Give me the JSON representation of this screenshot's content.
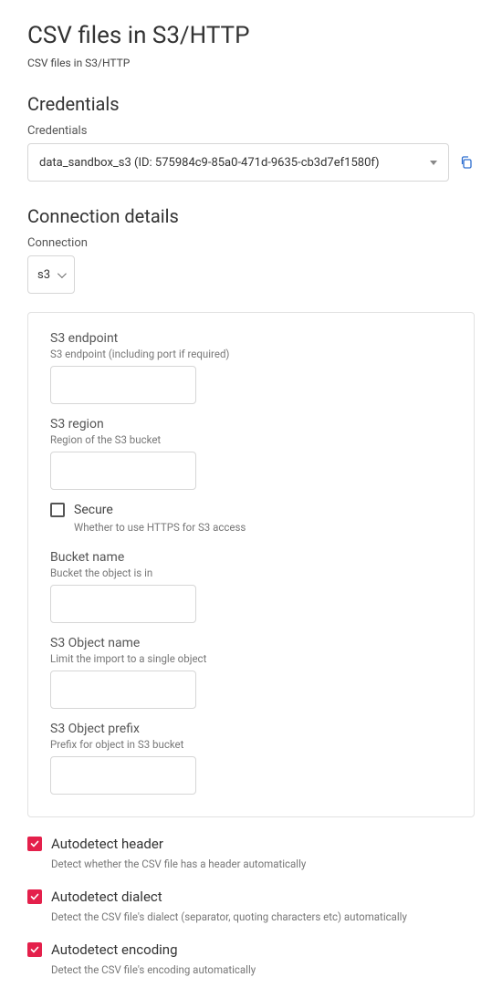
{
  "page": {
    "title": "CSV files in S3/HTTP",
    "subtitle": "CSV files in S3/HTTP"
  },
  "credentials": {
    "section_title": "Credentials",
    "field_label": "Credentials",
    "selected": "data_sandbox_s3 (ID: 575984c9-85a0-471d-9635-cb3d7ef1580f)"
  },
  "connection": {
    "section_title": "Connection details",
    "field_label": "Connection",
    "selected": "s3"
  },
  "s3_panel": {
    "endpoint": {
      "label": "S3 endpoint",
      "hint": "S3 endpoint (including port if required)",
      "value": ""
    },
    "region": {
      "label": "S3 region",
      "hint": "Region of the S3 bucket",
      "value": ""
    },
    "secure": {
      "label": "Secure",
      "hint": "Whether to use HTTPS for S3 access",
      "checked": false
    },
    "bucket": {
      "label": "Bucket name",
      "hint": "Bucket the object is in",
      "value": ""
    },
    "object_name": {
      "label": "S3 Object name",
      "hint": "Limit the import to a single object",
      "value": ""
    },
    "object_prefix": {
      "label": "S3 Object prefix",
      "hint": "Prefix for object in S3 bucket",
      "value": ""
    }
  },
  "options": {
    "autodetect_header": {
      "label": "Autodetect header",
      "hint": "Detect whether the CSV file has a header automatically",
      "checked": true
    },
    "autodetect_dialect": {
      "label": "Autodetect dialect",
      "hint": "Detect the CSV file's dialect (separator, quoting characters etc) automatically",
      "checked": true
    },
    "autodetect_encoding": {
      "label": "Autodetect encoding",
      "hint": "Detect the CSV file's encoding automatically",
      "checked": true
    }
  }
}
